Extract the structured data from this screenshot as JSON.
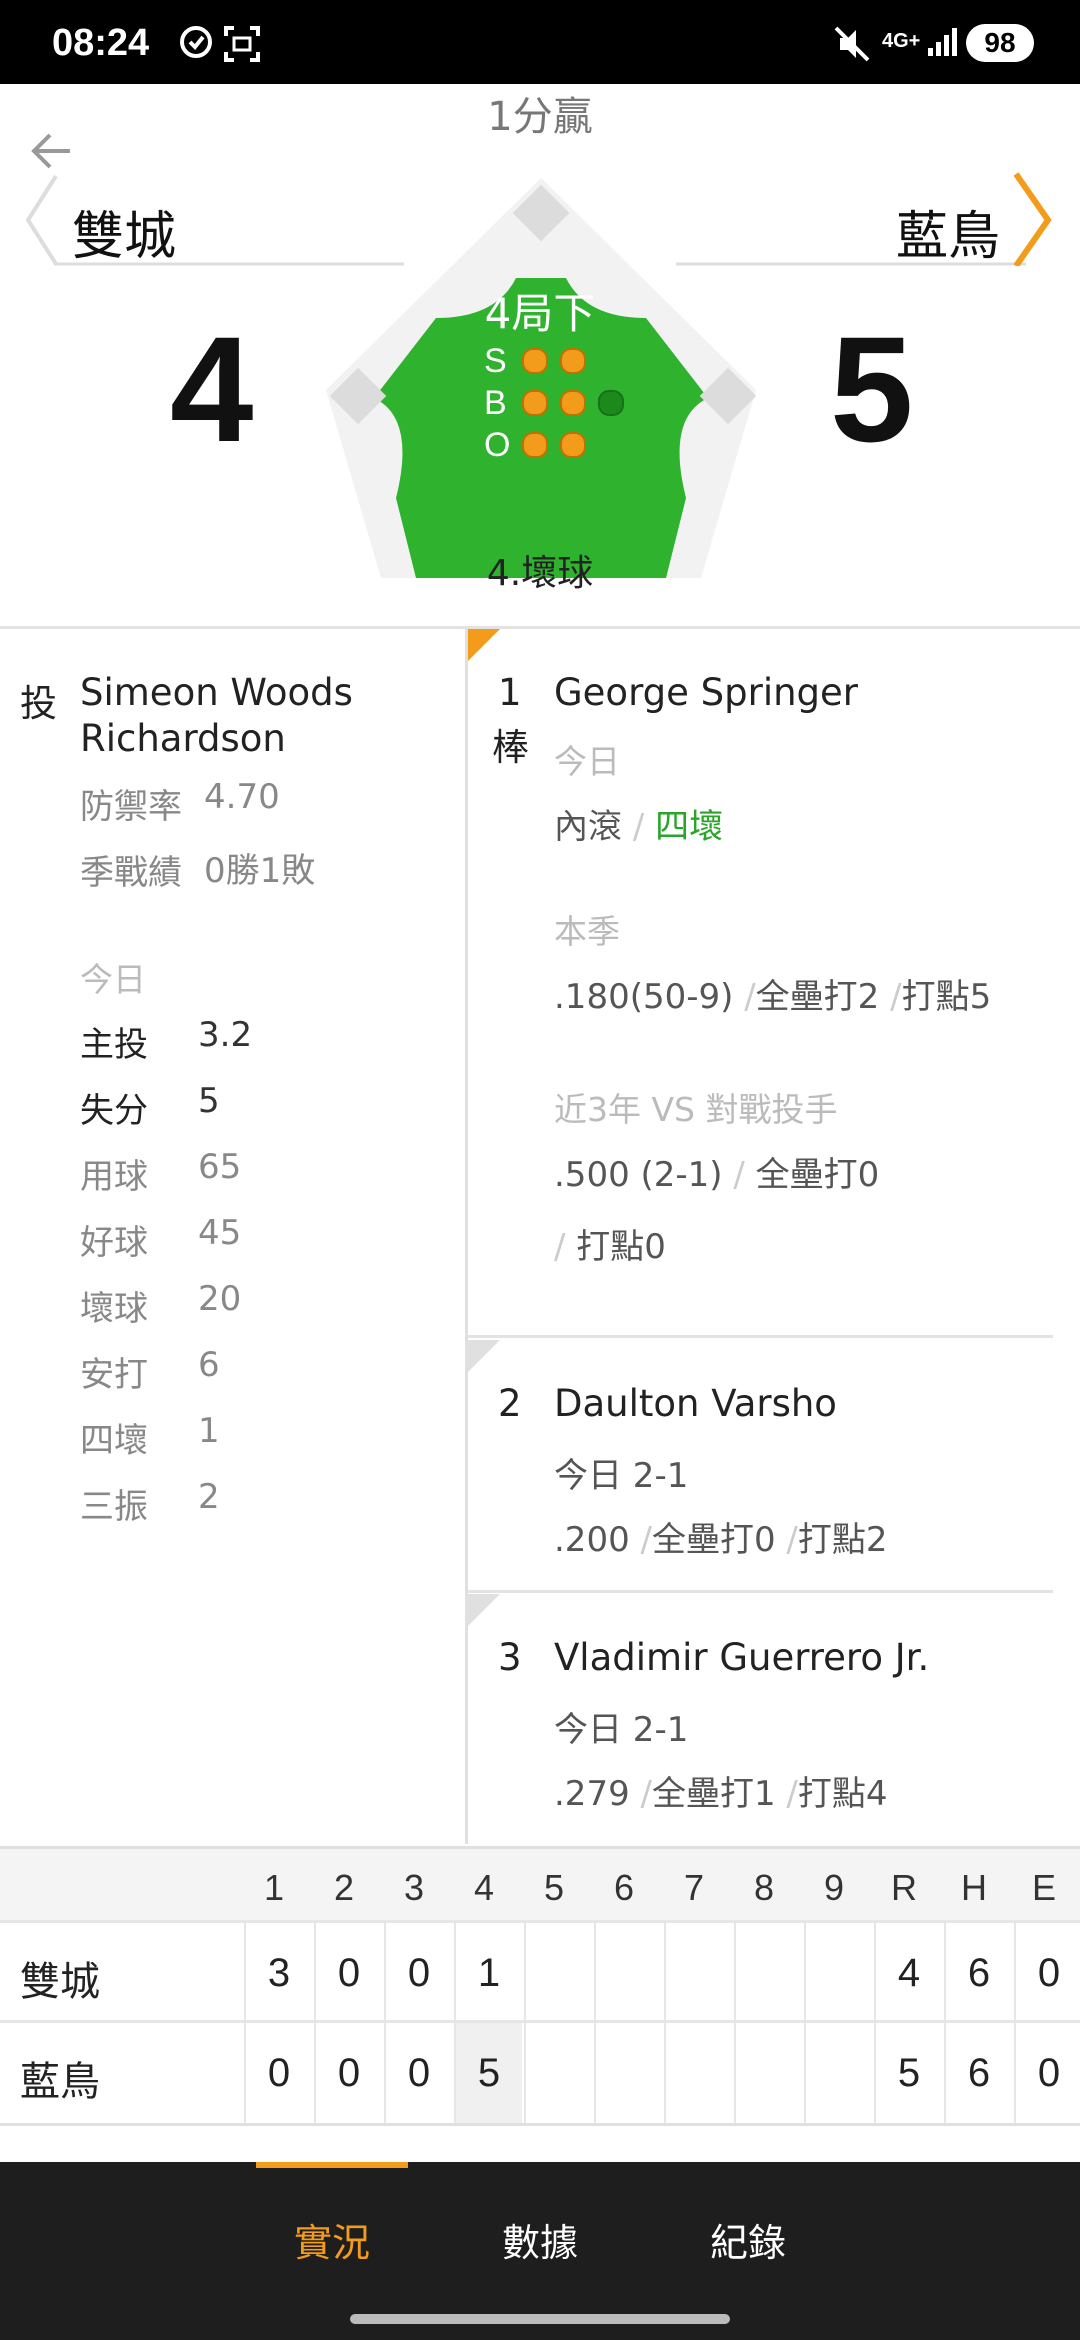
{
  "status_bar": {
    "time": "08:24",
    "network": "4G+",
    "battery": "98",
    "icons": [
      "location-icon",
      "screenshot-icon",
      "mute-icon",
      "signal-icon"
    ]
  },
  "game": {
    "lead_text": "1分贏",
    "away": {
      "name": "雙城",
      "score": "4"
    },
    "home": {
      "name": "藍鳥",
      "score": "5"
    },
    "inning": "4局下",
    "count_labels": {
      "s": "S",
      "b": "B",
      "o": "O"
    },
    "count": {
      "strikes": 2,
      "balls": 2,
      "outs": 2
    },
    "last_play": "4.壞球"
  },
  "pitcher": {
    "role_label": "投",
    "name_line1": "Simeon Woods",
    "name_line2": "Richardson",
    "era_label": "防禦率",
    "era_value": "4.70",
    "record_label": "季戰績",
    "record_value": "0勝1敗",
    "today_label": "今日",
    "stats": [
      {
        "label": "主投",
        "value": "3.2"
      },
      {
        "label": "失分",
        "value": "5"
      },
      {
        "label": "用球",
        "value": "65"
      },
      {
        "label": "好球",
        "value": "45"
      },
      {
        "label": "壞球",
        "value": "20"
      },
      {
        "label": "安打",
        "value": "6"
      },
      {
        "label": "四壞",
        "value": "1"
      },
      {
        "label": "三振",
        "value": "2"
      }
    ]
  },
  "batters": [
    {
      "order": "1",
      "order_suffix": "棒",
      "name": "George Springer",
      "today_label": "今日",
      "today_results": [
        "內滾",
        "四壞"
      ],
      "season_label": "本季",
      "season_avg": ".180(50-9)",
      "season_hr": "全壘打2",
      "season_rbi": "打點5",
      "vs_label": "近3年 VS 對戰投手",
      "vs_avg": ".500 (2-1)",
      "vs_hr": "全壘打0",
      "vs_rbi": "打點0"
    },
    {
      "order": "2",
      "name": "Daulton Varsho",
      "today": "今日 2-1",
      "avg": ".200",
      "hr": "全壘打0",
      "rbi": "打點2"
    },
    {
      "order": "3",
      "name": "Vladimir Guerrero Jr.",
      "today": "今日 2-1",
      "avg": ".279",
      "hr": "全壘打1",
      "rbi": "打點4"
    }
  ],
  "linescore": {
    "headers": [
      "1",
      "2",
      "3",
      "4",
      "5",
      "6",
      "7",
      "8",
      "9",
      "R",
      "H",
      "E"
    ],
    "rows": [
      {
        "team": "雙城",
        "cells": [
          "3",
          "0",
          "0",
          "1",
          "",
          "",
          "",
          "",
          "",
          "4",
          "6",
          "0"
        ]
      },
      {
        "team": "藍鳥",
        "cells": [
          "0",
          "0",
          "0",
          "5",
          "",
          "",
          "",
          "",
          "",
          "5",
          "6",
          "0"
        ]
      }
    ]
  },
  "tabs": [
    "實況",
    "數據",
    "紀錄"
  ],
  "active_tab": "實況",
  "colors": {
    "accent": "#f39b1a",
    "field_green": "#2fb32f",
    "positive": "#2aa52a"
  }
}
